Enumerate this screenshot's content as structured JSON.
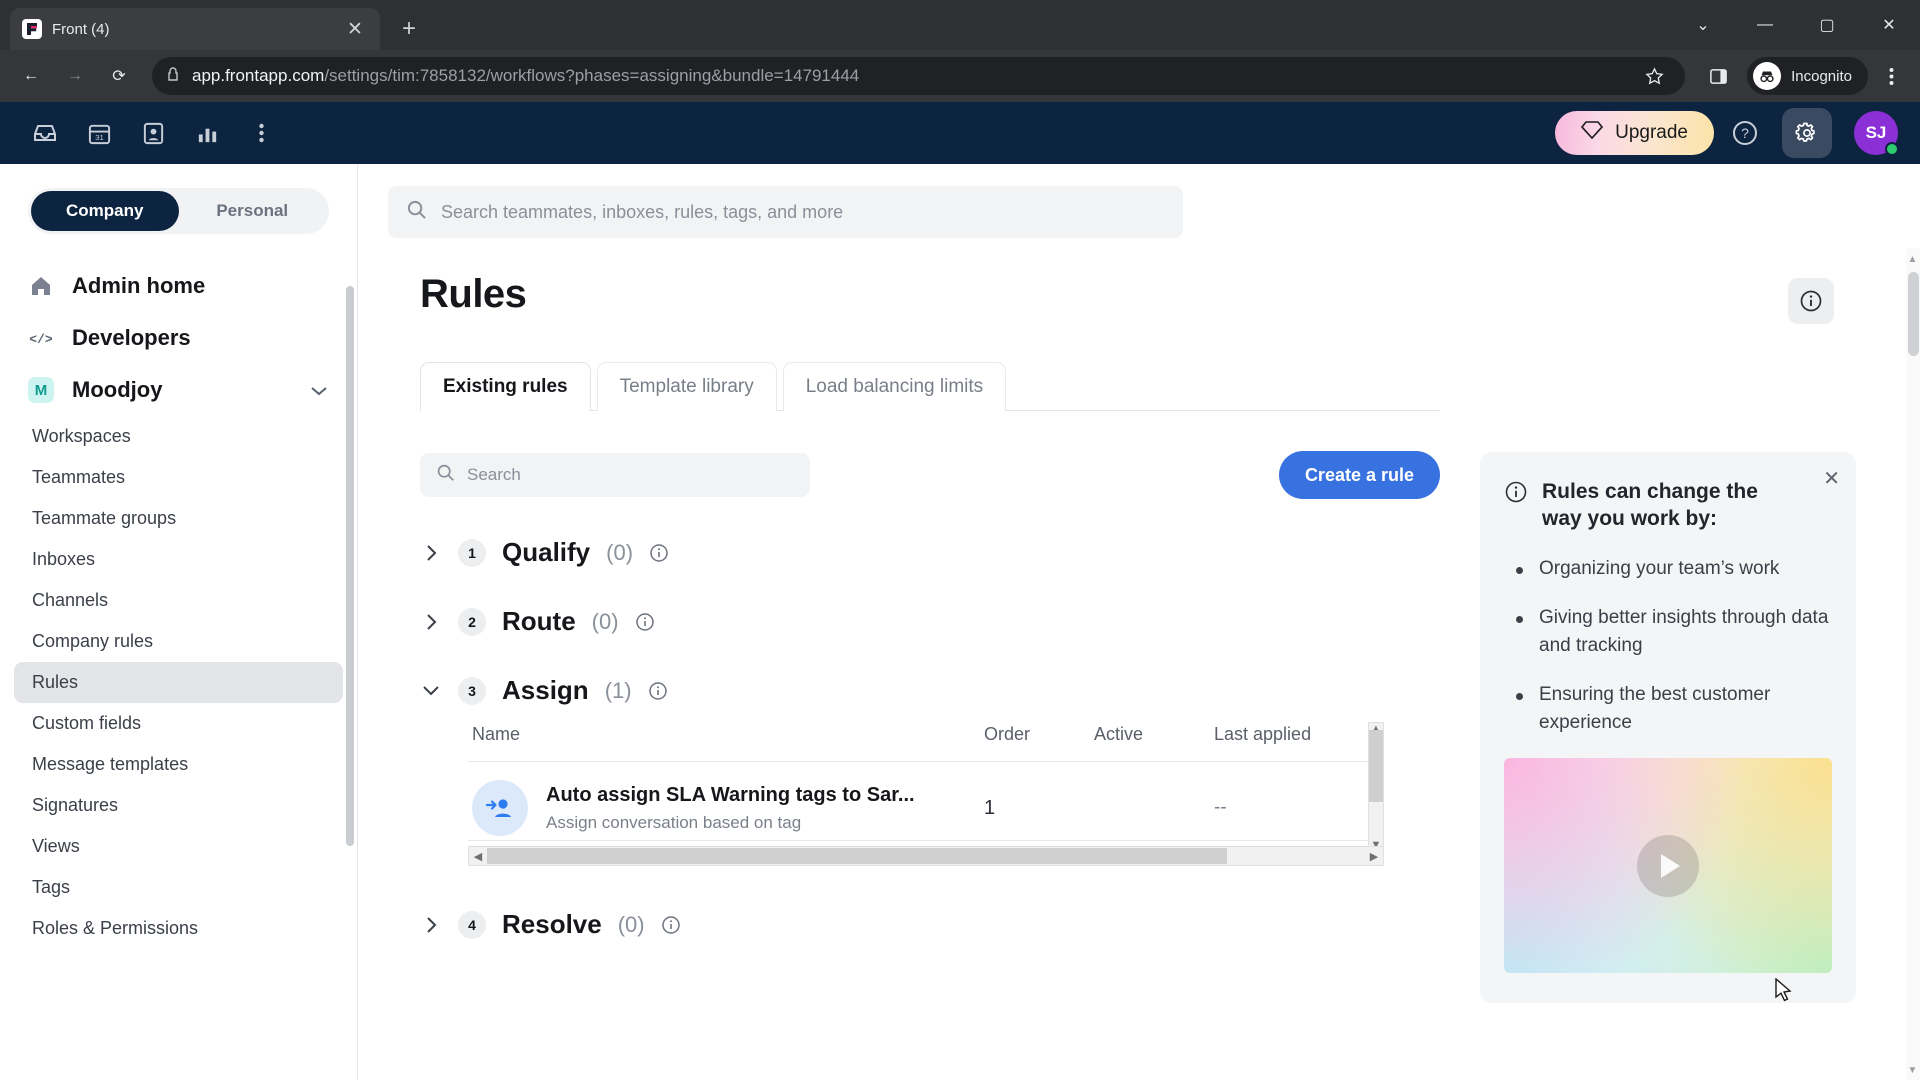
{
  "browser": {
    "tab": {
      "title": "Front (4)",
      "favicon_name": "front-logo-icon"
    },
    "new_tab_label": "+",
    "close_label": "✕",
    "window": {
      "minimize": "—",
      "maximize": "▢",
      "close": "✕",
      "collapse": "⌄"
    },
    "nav": {
      "back": "←",
      "forward": "→",
      "reload": "⟳"
    },
    "url_domain": "app.frontapp.com",
    "url_path": "/settings/tim:7858132/workflows?phases=assigning&bundle=14791444",
    "bookmark_icon": "star-icon",
    "sidepanel_icon": "side-panel-icon",
    "incognito_label": "Incognito",
    "menu_icon": "three-dot-menu-icon"
  },
  "appnav": {
    "icons": [
      "inbox-icon",
      "calendar-icon",
      "contacts-icon",
      "analytics-icon",
      "more-icon"
    ],
    "calendar_day": "31",
    "upgrade_label": "Upgrade",
    "upgrade_icon": "diamond-icon",
    "help_icon": "help-circle-icon",
    "gear_icon": "gear-icon",
    "avatar_initials": "SJ"
  },
  "sidebar": {
    "segments": [
      {
        "label": "Company",
        "active": true
      },
      {
        "label": "Personal",
        "active": false
      }
    ],
    "top_links": [
      {
        "label": "Admin home",
        "icon": "home-icon"
      },
      {
        "label": "Developers",
        "icon": "code-icon"
      }
    ],
    "group": {
      "label": "Moodjoy",
      "badge": "M",
      "chevron": "chevron-down-icon"
    },
    "items": [
      {
        "label": "Workspaces",
        "active": false
      },
      {
        "label": "Teammates",
        "active": false
      },
      {
        "label": "Teammate groups",
        "active": false
      },
      {
        "label": "Inboxes",
        "active": false
      },
      {
        "label": "Channels",
        "active": false
      },
      {
        "label": "Company rules",
        "active": false
      },
      {
        "label": "Rules",
        "active": true
      },
      {
        "label": "Custom fields",
        "active": false
      },
      {
        "label": "Message templates",
        "active": false
      },
      {
        "label": "Signatures",
        "active": false
      },
      {
        "label": "Views",
        "active": false
      },
      {
        "label": "Tags",
        "active": false
      },
      {
        "label": "Roles & Permissions",
        "active": false
      }
    ]
  },
  "topsearch": {
    "placeholder": "Search teammates, inboxes, rules, tags, and more",
    "icon": "search-icon"
  },
  "page": {
    "title": "Rules",
    "info_button_icon": "info-icon",
    "tabs": [
      {
        "label": "Existing rules",
        "active": true
      },
      {
        "label": "Template library",
        "active": false
      },
      {
        "label": "Load balancing limits",
        "active": false
      }
    ],
    "search_placeholder": "Search",
    "create_button": "Create a rule"
  },
  "phases": [
    {
      "num": "1",
      "name": "Qualify",
      "count": "(0)",
      "expanded": false,
      "chevron": "chevron-right-icon"
    },
    {
      "num": "2",
      "name": "Route",
      "count": "(0)",
      "expanded": false,
      "chevron": "chevron-right-icon"
    },
    {
      "num": "3",
      "name": "Assign",
      "count": "(1)",
      "expanded": true,
      "chevron": "chevron-down-icon"
    },
    {
      "num": "4",
      "name": "Resolve",
      "count": "(0)",
      "expanded": false,
      "chevron": "chevron-right-icon"
    }
  ],
  "table": {
    "columns": {
      "name": "Name",
      "order": "Order",
      "active": "Active",
      "last_applied": "Last applied"
    },
    "rows": [
      {
        "icon": "assign-person-icon",
        "name": "Auto assign SLA Warning tags to Sar...",
        "description": "Assign conversation based on tag",
        "order": "1",
        "active": true,
        "last_applied": "--"
      }
    ]
  },
  "info_panel": {
    "icon": "info-circle-icon",
    "close_label": "✕",
    "title": "Rules can change the way you work by:",
    "bullets": [
      "Organizing your team’s work",
      "Giving better insights through data and tracking",
      "Ensuring the best customer experience"
    ],
    "video_play_icon": "play-icon"
  },
  "colors": {
    "app_nav_bg": "#0d2440",
    "accent_blue": "#3871e0",
    "toggle_on": "#2f7bf0",
    "avatar_purple": "#8b2fd6",
    "status_green": "#2ecc6f",
    "sidebar_active_bg": "#e3e5e8"
  }
}
